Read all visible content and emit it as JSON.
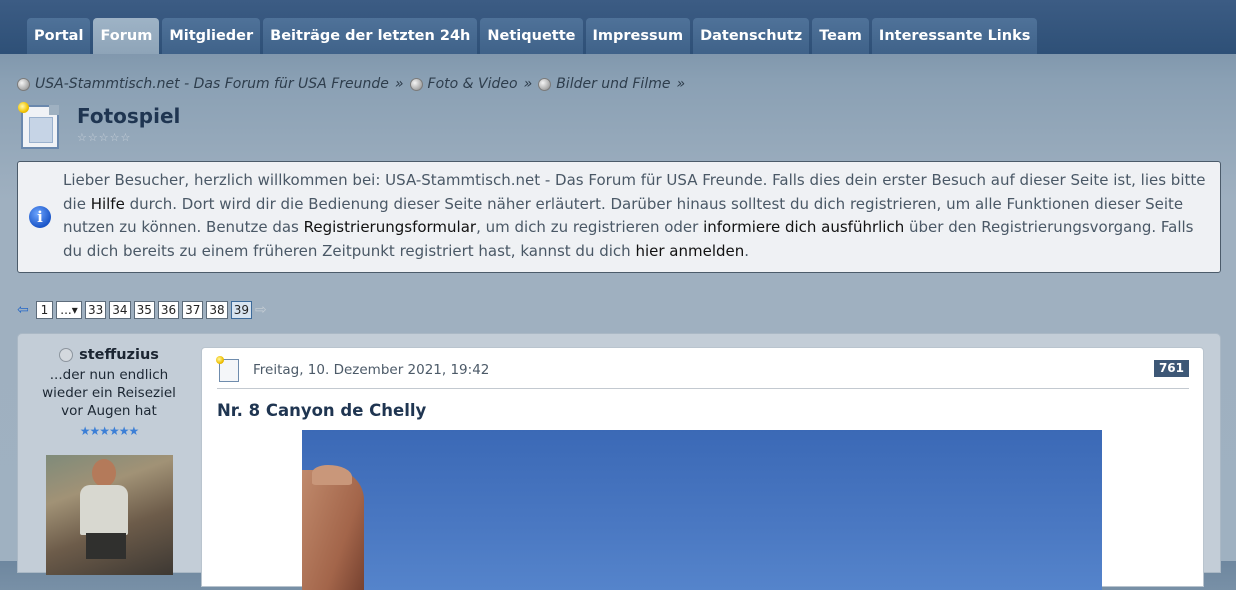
{
  "nav": {
    "tabs": [
      {
        "label": "Portal",
        "active": false
      },
      {
        "label": "Forum",
        "active": true
      },
      {
        "label": "Mitglieder",
        "active": false
      },
      {
        "label": "Beiträge der letzten 24h",
        "active": false
      },
      {
        "label": "Netiquette",
        "active": false
      },
      {
        "label": "Impressum",
        "active": false
      },
      {
        "label": "Datenschutz",
        "active": false
      },
      {
        "label": "Team",
        "active": false
      },
      {
        "label": "Interessante Links",
        "active": false
      }
    ]
  },
  "breadcrumb": [
    {
      "label": "USA-Stammtisch.net - Das Forum für USA Freunde",
      "sep": "»"
    },
    {
      "label": "Foto & Video",
      "sep": "»"
    },
    {
      "label": "Bilder und Filme",
      "sep": "»"
    }
  ],
  "page": {
    "title": "Fotospiel",
    "rating": "☆☆☆☆☆"
  },
  "infobox": {
    "icon": "info-icon",
    "t1": "Lieber Besucher, herzlich willkommen bei: USA-Stammtisch.net - Das Forum für USA Freunde. Falls dies dein erster Besuch auf dieser Seite ist, lies bitte die ",
    "link_hilfe": "Hilfe",
    "t2": " durch. Dort wird dir die Bedienung dieser Seite näher erläutert. Darüber hinaus solltest du dich registrieren, um alle Funktionen dieser Seite nutzen zu können. Benutze das ",
    "link_register": "Registrierungsformular",
    "t3": ", um dich zu registrieren oder ",
    "link_info": "informiere dich ausführlich",
    "t4": " über den Registrierungsvorgang. Falls du dich bereits zu einem früheren Zeitpunkt registriert hast, kannst du dich ",
    "link_login": "hier anmelden",
    "t5": "."
  },
  "pagination": {
    "first": "1",
    "ellipsis": "...▾",
    "pages": [
      "33",
      "34",
      "35",
      "36",
      "37",
      "38",
      "39"
    ],
    "current": "39"
  },
  "post": {
    "author": {
      "name": "steffuzius",
      "title": "...der nun endlich wieder ein Reiseziel vor Augen hat",
      "rank_stars": "★★★★★★"
    },
    "date": "Freitag, 10. Dezember 2021, 19:42",
    "number": "761",
    "subject": "Nr. 8 Canyon de Chelly"
  },
  "colors": {
    "nav_bg": "#2e5077",
    "tab_bg": "#4f7299",
    "tab_active": "#9eb3c6",
    "page_bg": "#9fb1c1",
    "title_color": "#1f3551",
    "post_number_bg": "#3d5776"
  }
}
